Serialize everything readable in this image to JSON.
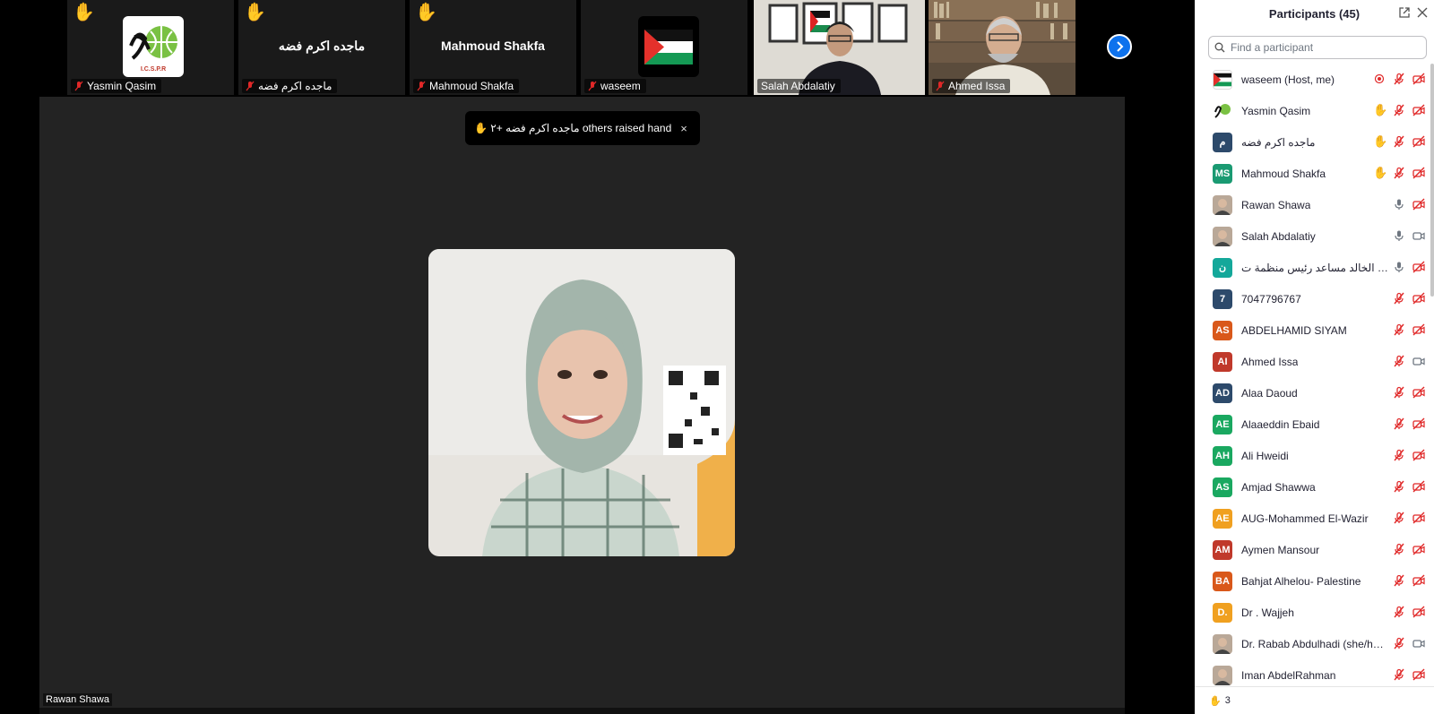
{
  "gallery": {
    "tiles": [
      {
        "name": "Yasmin Qasim",
        "hand": "✋",
        "logo_text": "I.C.S.P.R"
      },
      {
        "name": "ماجده اكرم فضه",
        "hand": "✋",
        "center_name": "ماجده اكرم فضه"
      },
      {
        "name": "Mahmoud Shakfa",
        "hand": "✋",
        "center_name": "Mahmoud Shakfa"
      },
      {
        "name": "waseem"
      },
      {
        "name": "Salah Abdalatiy"
      },
      {
        "name": "Ahmed Issa"
      }
    ]
  },
  "stage": {
    "toast_text": "✋ ماجده اكرم فضه +٢ others raised hands",
    "toast_close": "×",
    "speaker_name": "Rawan Shawa"
  },
  "panel": {
    "title": "Participants (45)",
    "search_placeholder": "Find a participant",
    "footer_hand": "✋",
    "footer_count": "3",
    "participants": [
      {
        "name": "waseem (Host, me)",
        "avatar": "flag",
        "hand": false,
        "mic": "muted",
        "cam": "off",
        "extra": "record"
      },
      {
        "name": "Yasmin Qasim",
        "avatar": "logo",
        "hand": true,
        "mic": "muted",
        "cam": "off"
      },
      {
        "name": "ماجده اكرم فضه",
        "avatar_text": "م",
        "avatar_color": "#2d4a6b",
        "hand": true,
        "mic": "muted",
        "cam": "off"
      },
      {
        "name": "Mahmoud Shakfa",
        "avatar_text": "MS",
        "avatar_color": "#1a9a72",
        "hand": true,
        "mic": "muted",
        "cam": "off"
      },
      {
        "name": "Rawan Shawa",
        "avatar": "photo",
        "hand": false,
        "mic": "on",
        "cam": "off"
      },
      {
        "name": "Salah Abdalatiy",
        "avatar": "photo",
        "hand": false,
        "mic": "on",
        "cam": "on"
      },
      {
        "name": "نزار الخالد مساعد رئيس منظمة ت...",
        "avatar_text": "ن",
        "avatar_color": "#14a89a",
        "hand": false,
        "mic": "on",
        "cam": "off"
      },
      {
        "name": "7047796767",
        "avatar_text": "7",
        "avatar_color": "#2d4a6b",
        "hand": false,
        "mic": "muted",
        "cam": "off"
      },
      {
        "name": "ABDELHAMID SIYAM",
        "avatar_text": "AS",
        "avatar_color": "#d9581a",
        "hand": false,
        "mic": "muted",
        "cam": "off"
      },
      {
        "name": "Ahmed Issa",
        "avatar_text": "AI",
        "avatar_color": "#c0392b",
        "hand": false,
        "mic": "muted",
        "cam": "on"
      },
      {
        "name": "Alaa Daoud",
        "avatar_text": "AD",
        "avatar_color": "#2d4a6b",
        "hand": false,
        "mic": "muted",
        "cam": "off"
      },
      {
        "name": "Alaaeddin Ebaid",
        "avatar_text": "AE",
        "avatar_color": "#1aa860",
        "hand": false,
        "mic": "muted",
        "cam": "off"
      },
      {
        "name": "Ali Hweidi",
        "avatar_text": "AH",
        "avatar_color": "#1aa860",
        "hand": false,
        "mic": "muted",
        "cam": "off"
      },
      {
        "name": "Amjad Shawwa",
        "avatar_text": "AS",
        "avatar_color": "#1aa860",
        "hand": false,
        "mic": "muted",
        "cam": "off"
      },
      {
        "name": "AUG-Mohammed El-Wazir",
        "avatar_text": "AE",
        "avatar_color": "#f0a020",
        "hand": false,
        "mic": "muted",
        "cam": "off"
      },
      {
        "name": "Aymen Mansour",
        "avatar_text": "AM",
        "avatar_color": "#c0392b",
        "hand": false,
        "mic": "muted",
        "cam": "off"
      },
      {
        "name": "Bahjat Alhelou- Palestine",
        "avatar_text": "BA",
        "avatar_color": "#d9581a",
        "hand": false,
        "mic": "muted",
        "cam": "off"
      },
      {
        "name": "Dr . Wajjeh",
        "avatar_text": "D.",
        "avatar_color": "#f0a020",
        "hand": false,
        "mic": "muted",
        "cam": "off"
      },
      {
        "name": "Dr. Rabab Abdulhadi (she/her),...",
        "avatar": "photo",
        "hand": false,
        "mic": "muted",
        "cam": "on"
      },
      {
        "name": "Iman AbdelRahman",
        "avatar": "photo",
        "hand": false,
        "mic": "muted",
        "cam": "off"
      }
    ]
  },
  "colors": {
    "accent": "#0e72ed",
    "muted_red": "#e02828",
    "tile_bg": "#1a1a1a",
    "stage_bg": "#232323"
  }
}
